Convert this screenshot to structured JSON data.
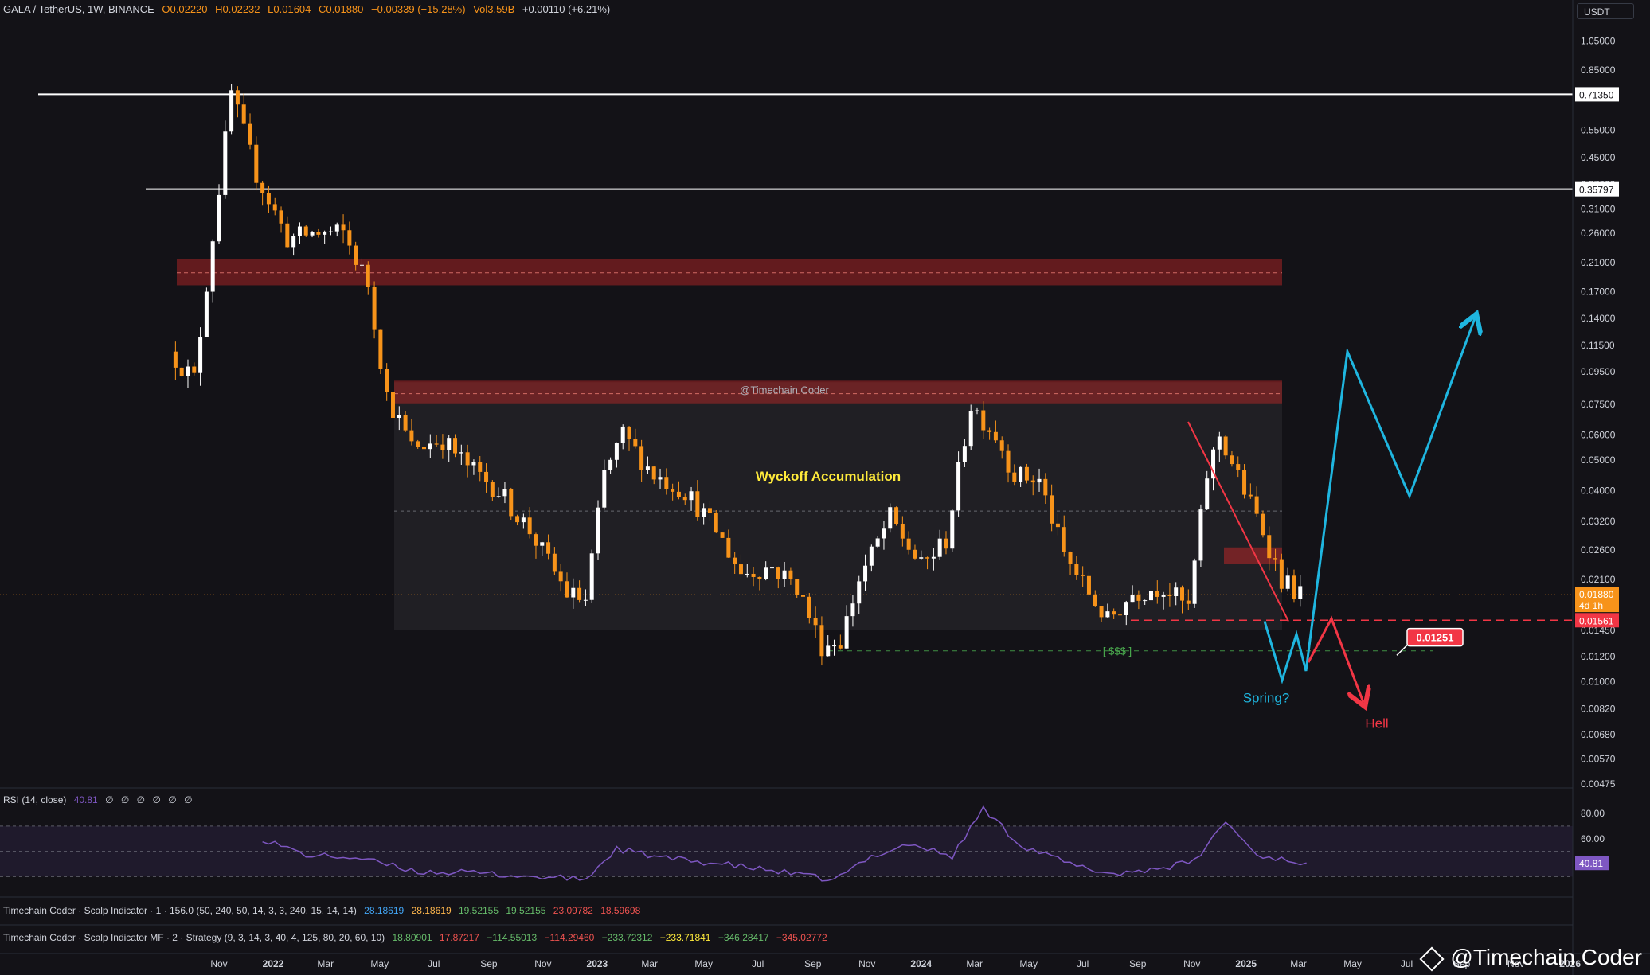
{
  "header": {
    "symbol": "GALA / TetherUS, 1W, BINANCE",
    "open": "O0.02220",
    "high": "H0.02232",
    "low": "L0.01604",
    "close": "C0.01880",
    "change": "−0.00339 (−15.28%)",
    "volume": "Vol3.59B",
    "vol_change": "+0.00110 (+6.21%)"
  },
  "unit_label": "USDT",
  "colors": {
    "background": "#131217",
    "bull": "#ffffff",
    "bear": "#f7931a",
    "zone_red": "#c62828",
    "blue_path": "#1fb6e0",
    "red_path": "#f23645",
    "rsi": "#7e57c2",
    "annotation_yellow": "#ffeb3b"
  },
  "chart_data": {
    "type": "candlestick",
    "scale": "log",
    "ylim": [
      0.00475,
      1.15
    ],
    "x_ticks": [
      "Nov",
      "2022",
      "Mar",
      "May",
      "Jul",
      "Sep",
      "Nov",
      "2023",
      "Mar",
      "May",
      "Jul",
      "Sep",
      "Nov",
      "2024",
      "Mar",
      "May",
      "Jul",
      "Sep",
      "Nov",
      "2025",
      "Mar",
      "May",
      "Jul",
      "Sep",
      "Nov",
      "2026"
    ],
    "y_ticks": [
      "1.05000",
      "0.85000",
      "0.55000",
      "0.45000",
      "0.37000",
      "0.31000",
      "0.26000",
      "0.21000",
      "0.17000",
      "0.14000",
      "0.11500",
      "0.09500",
      "0.07500",
      "0.06000",
      "0.05000",
      "0.04000",
      "0.03200",
      "0.02600",
      "0.02100",
      "0.01450",
      "0.01200",
      "0.01000",
      "0.00820",
      "0.00680",
      "0.00570",
      "0.00475"
    ],
    "price_levels": [
      {
        "label": "0.71350",
        "value": 0.7135
      },
      {
        "label": "0.35797",
        "value": 0.35797
      }
    ],
    "last_price": {
      "label": "0.01880",
      "countdown": "4d 1h",
      "value": 0.0188
    },
    "marker_price": {
      "label": "0.01561",
      "value": 0.01561
    },
    "target_price": {
      "label": "0.01251",
      "value": 0.01251
    },
    "price_path": [
      {
        "date": "2021-09-13",
        "value": 0.11
      },
      {
        "date": "2021-10-11",
        "value": 0.09
      },
      {
        "date": "2021-11-22",
        "value": 0.72
      },
      {
        "date": "2021-12-20",
        "value": 0.4
      },
      {
        "date": "2022-01-24",
        "value": 0.25
      },
      {
        "date": "2022-02-21",
        "value": 0.26
      },
      {
        "date": "2022-03-28",
        "value": 0.26
      },
      {
        "date": "2022-04-25",
        "value": 0.18
      },
      {
        "date": "2022-05-16",
        "value": 0.08
      },
      {
        "date": "2022-06-13",
        "value": 0.055
      },
      {
        "date": "2022-07-18",
        "value": 0.058
      },
      {
        "date": "2022-08-15",
        "value": 0.048
      },
      {
        "date": "2022-09-19",
        "value": 0.04
      },
      {
        "date": "2022-10-24",
        "value": 0.03
      },
      {
        "date": "2022-12-05",
        "value": 0.019
      },
      {
        "date": "2022-12-26",
        "value": 0.018
      },
      {
        "date": "2023-01-16",
        "value": 0.045
      },
      {
        "date": "2023-02-06",
        "value": 0.06
      },
      {
        "date": "2023-03-13",
        "value": 0.045
      },
      {
        "date": "2023-04-17",
        "value": 0.04
      },
      {
        "date": "2023-05-22",
        "value": 0.03
      },
      {
        "date": "2023-06-19",
        "value": 0.022
      },
      {
        "date": "2023-07-24",
        "value": 0.023
      },
      {
        "date": "2023-08-21",
        "value": 0.02
      },
      {
        "date": "2023-09-18",
        "value": 0.013
      },
      {
        "date": "2023-10-09",
        "value": 0.0135
      },
      {
        "date": "2023-10-30",
        "value": 0.021
      },
      {
        "date": "2023-12-04",
        "value": 0.033
      },
      {
        "date": "2024-01-08",
        "value": 0.023
      },
      {
        "date": "2024-02-05",
        "value": 0.028
      },
      {
        "date": "2024-03-04",
        "value": 0.075
      },
      {
        "date": "2024-04-01",
        "value": 0.06
      },
      {
        "date": "2024-04-22",
        "value": 0.045
      },
      {
        "date": "2024-05-20",
        "value": 0.043
      },
      {
        "date": "2024-06-17",
        "value": 0.025
      },
      {
        "date": "2024-07-15",
        "value": 0.019
      },
      {
        "date": "2024-08-05",
        "value": 0.0155
      },
      {
        "date": "2024-09-02",
        "value": 0.019
      },
      {
        "date": "2024-10-07",
        "value": 0.02
      },
      {
        "date": "2024-11-04",
        "value": 0.017
      },
      {
        "date": "2024-11-25",
        "value": 0.045
      },
      {
        "date": "2024-12-09",
        "value": 0.06
      },
      {
        "date": "2025-01-06",
        "value": 0.04
      },
      {
        "date": "2025-01-27",
        "value": 0.03
      },
      {
        "date": "2025-02-17",
        "value": 0.021
      },
      {
        "date": "2025-03-10",
        "value": 0.0188
      }
    ],
    "rsi": {
      "label": "RSI (14, close)",
      "value": "40.81",
      "value_num": 40.81,
      "extra_values": [
        "∅",
        "∅",
        "∅",
        "∅",
        "∅",
        "∅"
      ],
      "y_ticks": [
        "80.00",
        "60.00"
      ],
      "bands": [
        70,
        50,
        30
      ],
      "series": [
        {
          "date": "2021-12-20",
          "value": 60
        },
        {
          "date": "2022-02-07",
          "value": 47
        },
        {
          "date": "2022-04-04",
          "value": 45
        },
        {
          "date": "2022-06-13",
          "value": 34
        },
        {
          "date": "2022-08-15",
          "value": 33
        },
        {
          "date": "2022-10-17",
          "value": 30
        },
        {
          "date": "2022-12-19",
          "value": 28
        },
        {
          "date": "2023-01-23",
          "value": 52
        },
        {
          "date": "2023-03-13",
          "value": 45
        },
        {
          "date": "2023-05-22",
          "value": 40
        },
        {
          "date": "2023-07-24",
          "value": 34
        },
        {
          "date": "2023-09-25",
          "value": 27
        },
        {
          "date": "2023-11-06",
          "value": 46
        },
        {
          "date": "2023-12-18",
          "value": 56
        },
        {
          "date": "2024-02-05",
          "value": 46
        },
        {
          "date": "2024-03-11",
          "value": 84
        },
        {
          "date": "2024-04-22",
          "value": 55
        },
        {
          "date": "2024-06-24",
          "value": 38
        },
        {
          "date": "2024-08-05",
          "value": 32
        },
        {
          "date": "2024-10-07",
          "value": 38
        },
        {
          "date": "2024-11-04",
          "value": 42
        },
        {
          "date": "2024-12-09",
          "value": 74
        },
        {
          "date": "2025-01-13",
          "value": 47
        },
        {
          "date": "2025-03-10",
          "value": 40.81
        }
      ]
    }
  },
  "annotations": {
    "author_tag": "@Timechain Coder",
    "pattern_label": "Wyckoff Accumulation",
    "liquidity_label": "[ $$$ ]",
    "spring_label": "Spring?",
    "hell_label": "Hell",
    "watermark": "@Timechain Coder"
  },
  "indicators": [
    {
      "name": "Timechain Coder · Scalp Indicator · 1 · 156.0 (50, 240, 50, 14, 3, 3, 240, 15, 14, 14)",
      "values": [
        {
          "v": "28.18619",
          "c": "#42a5f5"
        },
        {
          "v": "28.18619",
          "c": "#ffb74d"
        },
        {
          "v": "19.52155",
          "c": "#66bb6a"
        },
        {
          "v": "19.52155",
          "c": "#66bb6a"
        },
        {
          "v": "23.09782",
          "c": "#ef5350"
        },
        {
          "v": "18.59698",
          "c": "#ef5350"
        }
      ]
    },
    {
      "name": "Timechain Coder · Scalp Indicator MF · 2 · Strategy (9, 3, 14, 3, 40, 4, 125, 80, 20, 60, 10)",
      "values": [
        {
          "v": "18.80901",
          "c": "#66bb6a"
        },
        {
          "v": "17.87217",
          "c": "#ef5350"
        },
        {
          "v": "−114.55013",
          "c": "#66bb6a"
        },
        {
          "v": "−114.29460",
          "c": "#ef5350"
        },
        {
          "v": "−233.72312",
          "c": "#66bb6a"
        },
        {
          "v": "−233.71841",
          "c": "#ffeb3b"
        },
        {
          "v": "−346.28417",
          "c": "#66bb6a"
        },
        {
          "v": "−345.02772",
          "c": "#ef5350"
        }
      ]
    }
  ]
}
